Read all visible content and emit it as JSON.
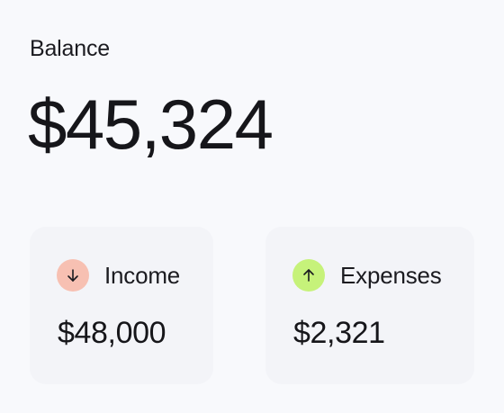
{
  "balance": {
    "label": "Balance",
    "amount": "$45,324"
  },
  "stats": {
    "income": {
      "label": "Income",
      "value": "$48,000",
      "icon": "arrow-down-icon",
      "icon_bg": "#f7c0b2"
    },
    "expenses": {
      "label": "Expenses",
      "value": "$2,321",
      "icon": "arrow-up-icon",
      "icon_bg": "#c6f27a"
    }
  }
}
